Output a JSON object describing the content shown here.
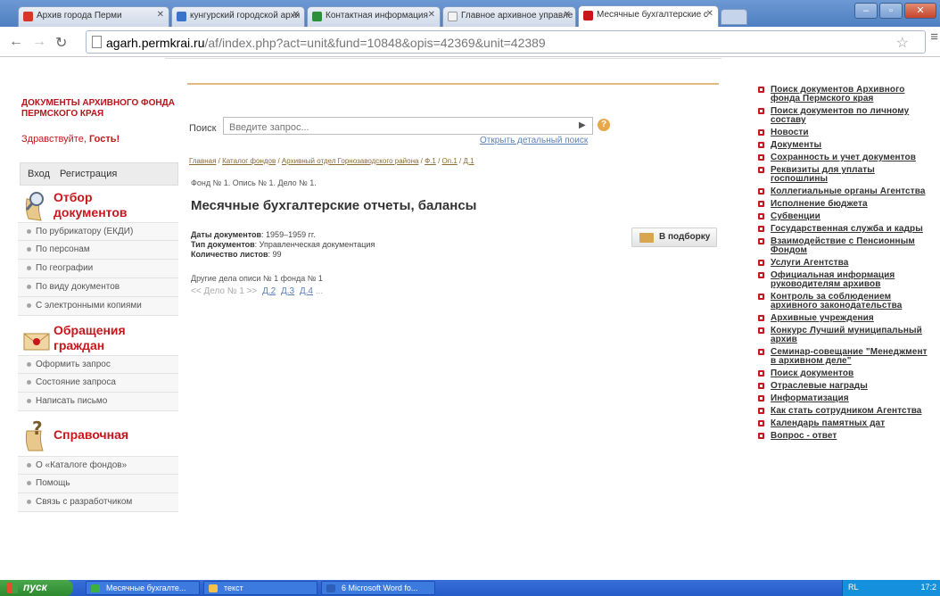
{
  "browser": {
    "tabs": [
      {
        "label": "Архив города Перми",
        "favicon_color": "#d9342b",
        "active": false
      },
      {
        "label": "кунгурский городской архи",
        "favicon_color": "#3a73c9",
        "active": false
      },
      {
        "label": "Контактная информация",
        "favicon_color": "#2d8f3a",
        "active": false
      },
      {
        "label": "Главное архивное управле",
        "favicon_color": "#f3f3f3",
        "active": false
      },
      {
        "label": "Месячные бухгалтерские с",
        "favicon_color": "#c8161c",
        "active": true
      }
    ],
    "url_prefix": "agarh.permkrai.ru",
    "url_rest": "/af/index.php?act=unit&fund=10848&opis=42369&unit=42389"
  },
  "left": {
    "archive_title": "ДОКУМЕНТЫ АРХИВНОГО ФОНДА ПЕРМСКОГО КРАЯ",
    "greeting": "Здравствуйте, ",
    "greeting_name": "Гость!",
    "login": "Вход",
    "register": "Регистрация",
    "sections": [
      {
        "title_line1": "Отбор",
        "title_line2": "документов",
        "icon": "magnifier-scroll-icon",
        "items": [
          "По рубрикатору (ЕКДИ)",
          "По персонам",
          "По географии",
          "По виду документов",
          "С электронными копиями"
        ]
      },
      {
        "title_line1": "Обращения",
        "title_line2": "граждан",
        "icon": "envelope-icon",
        "items": [
          "Оформить запрос",
          "Состояние запроса",
          "Написать письмо"
        ]
      },
      {
        "title_line1": "Справочная",
        "title_line2": "",
        "icon": "question-scroll-icon",
        "items": [
          "О «Каталоге фондов»",
          "Помощь",
          "Связь с разработчиком"
        ]
      }
    ]
  },
  "center": {
    "search_label": "Поиск",
    "search_placeholder": "Введите запрос...",
    "advanced_link": "Открыть детальный поиск",
    "breadcrumbs": [
      "Главная",
      "Каталог фондов",
      "Архивный отдел Горнозаводского района",
      "Ф.1",
      "Оп.1",
      "Д.1"
    ],
    "breadcrumb_sep": " / ",
    "fond_line": "Фонд № 1. Опись № 1. Дело № 1.",
    "title": "Месячные бухгалтерские отчеты, балансы",
    "meta": [
      {
        "label": "Даты документов",
        "value": "1959–1959 гг."
      },
      {
        "label": "Тип документов",
        "value": "Управленческая документация"
      },
      {
        "label": "Количество листов",
        "value": "99"
      }
    ],
    "add_button": "В подборку",
    "other_line": "Другие дела описи № 1 фонда № 1",
    "pager_prev": "<< Дело № 1 >>",
    "pager_links": [
      "Д.2",
      "Д.3",
      "Д.4"
    ],
    "pager_more": "..."
  },
  "right": {
    "links": [
      "Поиск документов Архивного фонда Пермского края",
      "Поиск документов по личному составу",
      "Новости",
      "Документы",
      "Сохранность и учет документов",
      "Реквизиты для уплаты госпошлины",
      "Коллегиальные органы Агентства",
      "Исполнение бюджета",
      "Субвенции",
      "Государственная служба и кадры",
      "Взаимодействие с Пенсионным Фондом",
      "Услуги Агентства",
      "Официальная информация руководителям архивов",
      "Контроль за соблюдением архивного законодательства",
      "Архивные учреждения",
      "Конкурс Лучший муниципальный архив",
      "Семинар-совещание \"Менеджмент в архивном деле\"",
      "Поиск документов",
      "Отраслевые награды",
      "Информатизация",
      "Как стать сотрудником Агентства",
      "Календарь памятных дат",
      "Вопрос - ответ"
    ]
  },
  "taskbar": {
    "start": "пуск",
    "tasks": [
      {
        "label": "Месячные бухгалте...",
        "icon_color": "#3cb043"
      },
      {
        "label": "текст",
        "icon_color": "#f2c34a"
      },
      {
        "label": "6 Microsoft Word fo...",
        "icon_color": "#2e5fb8"
      }
    ],
    "lang": "RL",
    "clock": "17:2"
  },
  "colors": {
    "accent_red": "#c8161c",
    "link_blue": "#5d7fb8",
    "gold": "#e1b981"
  }
}
